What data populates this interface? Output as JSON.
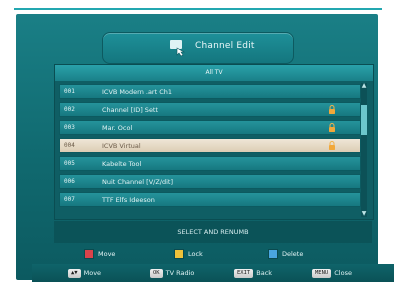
{
  "title": {
    "text": "Channel Edit",
    "icon": "hand-pointer-icon"
  },
  "list": {
    "header": "All TV",
    "rows": [
      {
        "num": "001",
        "name": "ICVB Modern .art Ch1",
        "locked": false,
        "selected": false
      },
      {
        "num": "002",
        "name": "Channel [ID] Sett",
        "locked": true,
        "selected": false
      },
      {
        "num": "003",
        "name": "Mar. Ocol",
        "locked": true,
        "selected": false
      },
      {
        "num": "004",
        "name": "ICVB Virtual",
        "locked": true,
        "selected": true
      },
      {
        "num": "005",
        "name": "Kabelte Tool",
        "locked": false,
        "selected": false
      },
      {
        "num": "006",
        "name": "Nuit Channel [V/Z/dit]",
        "locked": false,
        "selected": false
      },
      {
        "num": "007",
        "name": "TTF Elfs Ideeson",
        "locked": false,
        "selected": false
      }
    ]
  },
  "help_text": "SELECT AND RENUMB",
  "legend": [
    {
      "label": "Move",
      "color": "#d9434b"
    },
    {
      "label": "Lock",
      "color": "#f0c23a"
    },
    {
      "label": "Delete",
      "color": "#4aa6e0"
    }
  ],
  "footer_keys": [
    {
      "key": "▲▼",
      "label": "Move"
    },
    {
      "key": "OK",
      "label": "TV Radio"
    },
    {
      "key": "EXIT",
      "label": "Back"
    },
    {
      "key": "MENU",
      "label": "Close"
    }
  ],
  "colors": {
    "background": "#10696f",
    "selected_row": "#efe6d7",
    "accent": "#23a7b0"
  }
}
